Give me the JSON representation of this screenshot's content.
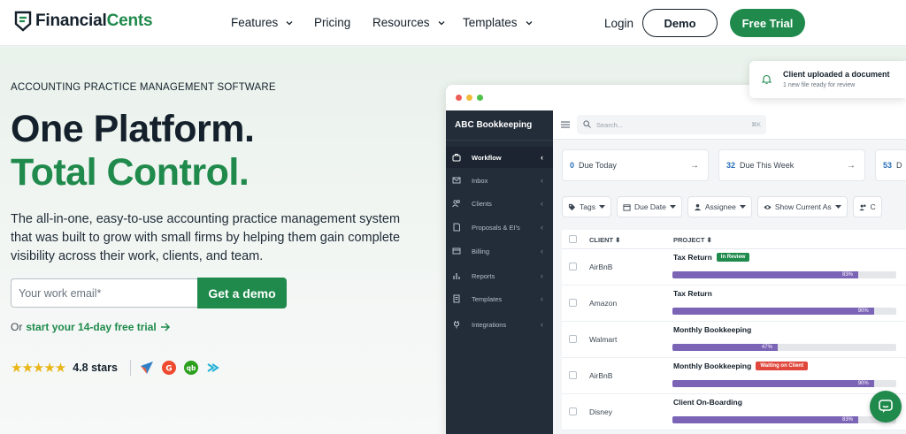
{
  "brand": {
    "name_part1": "Financial",
    "name_part2": "Cents",
    "brand_color": "#1f8a4c"
  },
  "nav": {
    "links": [
      {
        "label": "Features",
        "has_dropdown": true
      },
      {
        "label": "Pricing",
        "has_dropdown": false
      },
      {
        "label": "Resources",
        "has_dropdown": true
      },
      {
        "label": "Templates",
        "has_dropdown": true
      }
    ],
    "login_label": "Login",
    "demo_label": "Demo",
    "trial_label": "Free Trial"
  },
  "hero": {
    "eyebrow": "ACCOUNTING PRACTICE MANAGEMENT SOFTWARE",
    "headline_line1": "One Platform.",
    "headline_line2": "Total Control.",
    "description": "The all-in-one, easy-to-use accounting practice management system that was built to grow with small firms by helping them gain complete visibility across their work, clients, and team.",
    "email_placeholder": "Your work email*",
    "cta_label": "Get a demo",
    "trial_prefix": "Or",
    "trial_link": "start your 14-day free trial",
    "rating_stars": "★★★★★",
    "rating_text": "4.8 stars"
  },
  "app": {
    "company": "ABC Bookkeeping",
    "sidebar": [
      {
        "label": "Workflow",
        "icon": "briefcase-icon",
        "active": true
      },
      {
        "label": "Inbox",
        "icon": "mail-icon",
        "active": false
      },
      {
        "label": "Clients",
        "icon": "users-icon",
        "active": false
      },
      {
        "label": "Proposals & EI's",
        "icon": "document-icon",
        "active": false
      },
      {
        "label": "Billing",
        "icon": "billing-icon",
        "active": false
      },
      {
        "label": "Reports",
        "icon": "chart-icon",
        "active": false
      },
      {
        "label": "Templates",
        "icon": "template-icon",
        "active": false
      },
      {
        "label": "Integrations",
        "icon": "plug-icon",
        "active": false
      }
    ],
    "search_placeholder": "Search...",
    "search_shortcut": "⌘K",
    "cards": [
      {
        "count": "0",
        "label": "Due Today"
      },
      {
        "count": "32",
        "label": "Due This Week"
      },
      {
        "count": "53",
        "label": "D"
      }
    ],
    "filters": [
      {
        "label": "Tags",
        "icon": "tag-icon"
      },
      {
        "label": "Due Date",
        "icon": "calendar-icon"
      },
      {
        "label": "Assignee",
        "icon": "person-icon"
      },
      {
        "label": "Show Current As",
        "icon": "eye-icon"
      },
      {
        "label": "C",
        "icon": "users-icon"
      }
    ],
    "table": {
      "col_client": "CLIENT",
      "col_project": "PROJECT",
      "rows": [
        {
          "client": "AirBnB",
          "project": "Tax Return",
          "badge": "In Review",
          "badge_color": "#1f8a4c",
          "progress": 83,
          "progress_label": "83%"
        },
        {
          "client": "Amazon",
          "project": "Tax Return",
          "badge": "",
          "badge_color": "",
          "progress": 90,
          "progress_label": "90%"
        },
        {
          "client": "Walmart",
          "project": "Monthly Bookkeeping",
          "badge": "",
          "badge_color": "",
          "progress": 47,
          "progress_label": "47%"
        },
        {
          "client": "AirBnB",
          "project": "Monthly Bookkeeping",
          "badge": "Waiting on Client",
          "badge_color": "#e0463c",
          "progress": 90,
          "progress_label": "90%"
        },
        {
          "client": "Disney",
          "project": "Client On-Boarding",
          "badge": "",
          "badge_color": "",
          "progress": 83,
          "progress_label": "83%"
        }
      ]
    }
  },
  "notification": {
    "title": "Client uploaded a document",
    "subtitle": "1 new file ready for review"
  }
}
